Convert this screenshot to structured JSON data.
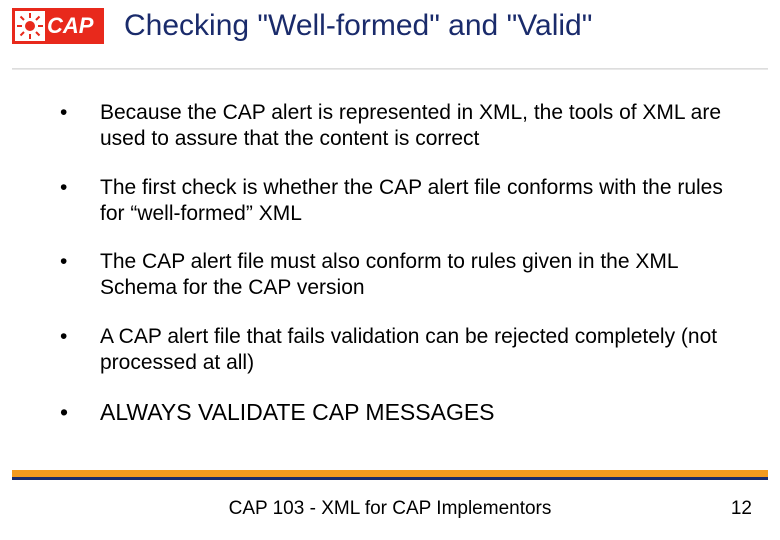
{
  "logo": {
    "text": "CAP"
  },
  "title": "Checking \"Well-formed\" and \"Valid\"",
  "bullets": [
    "Because the CAP alert is represented in XML, the tools of XML are used to assure that the content is correct",
    "The first check is whether the CAP alert file conforms with the rules for “well-formed” XML",
    "The CAP alert file must also conform to rules given in the XML Schema for the CAP version",
    "A CAP alert file that fails validation can be rejected completely (not processed at all)",
    "ALWAYS VALIDATE CAP MESSAGES"
  ],
  "footer": "CAP 103 - XML for CAP Implementors",
  "page": "12"
}
